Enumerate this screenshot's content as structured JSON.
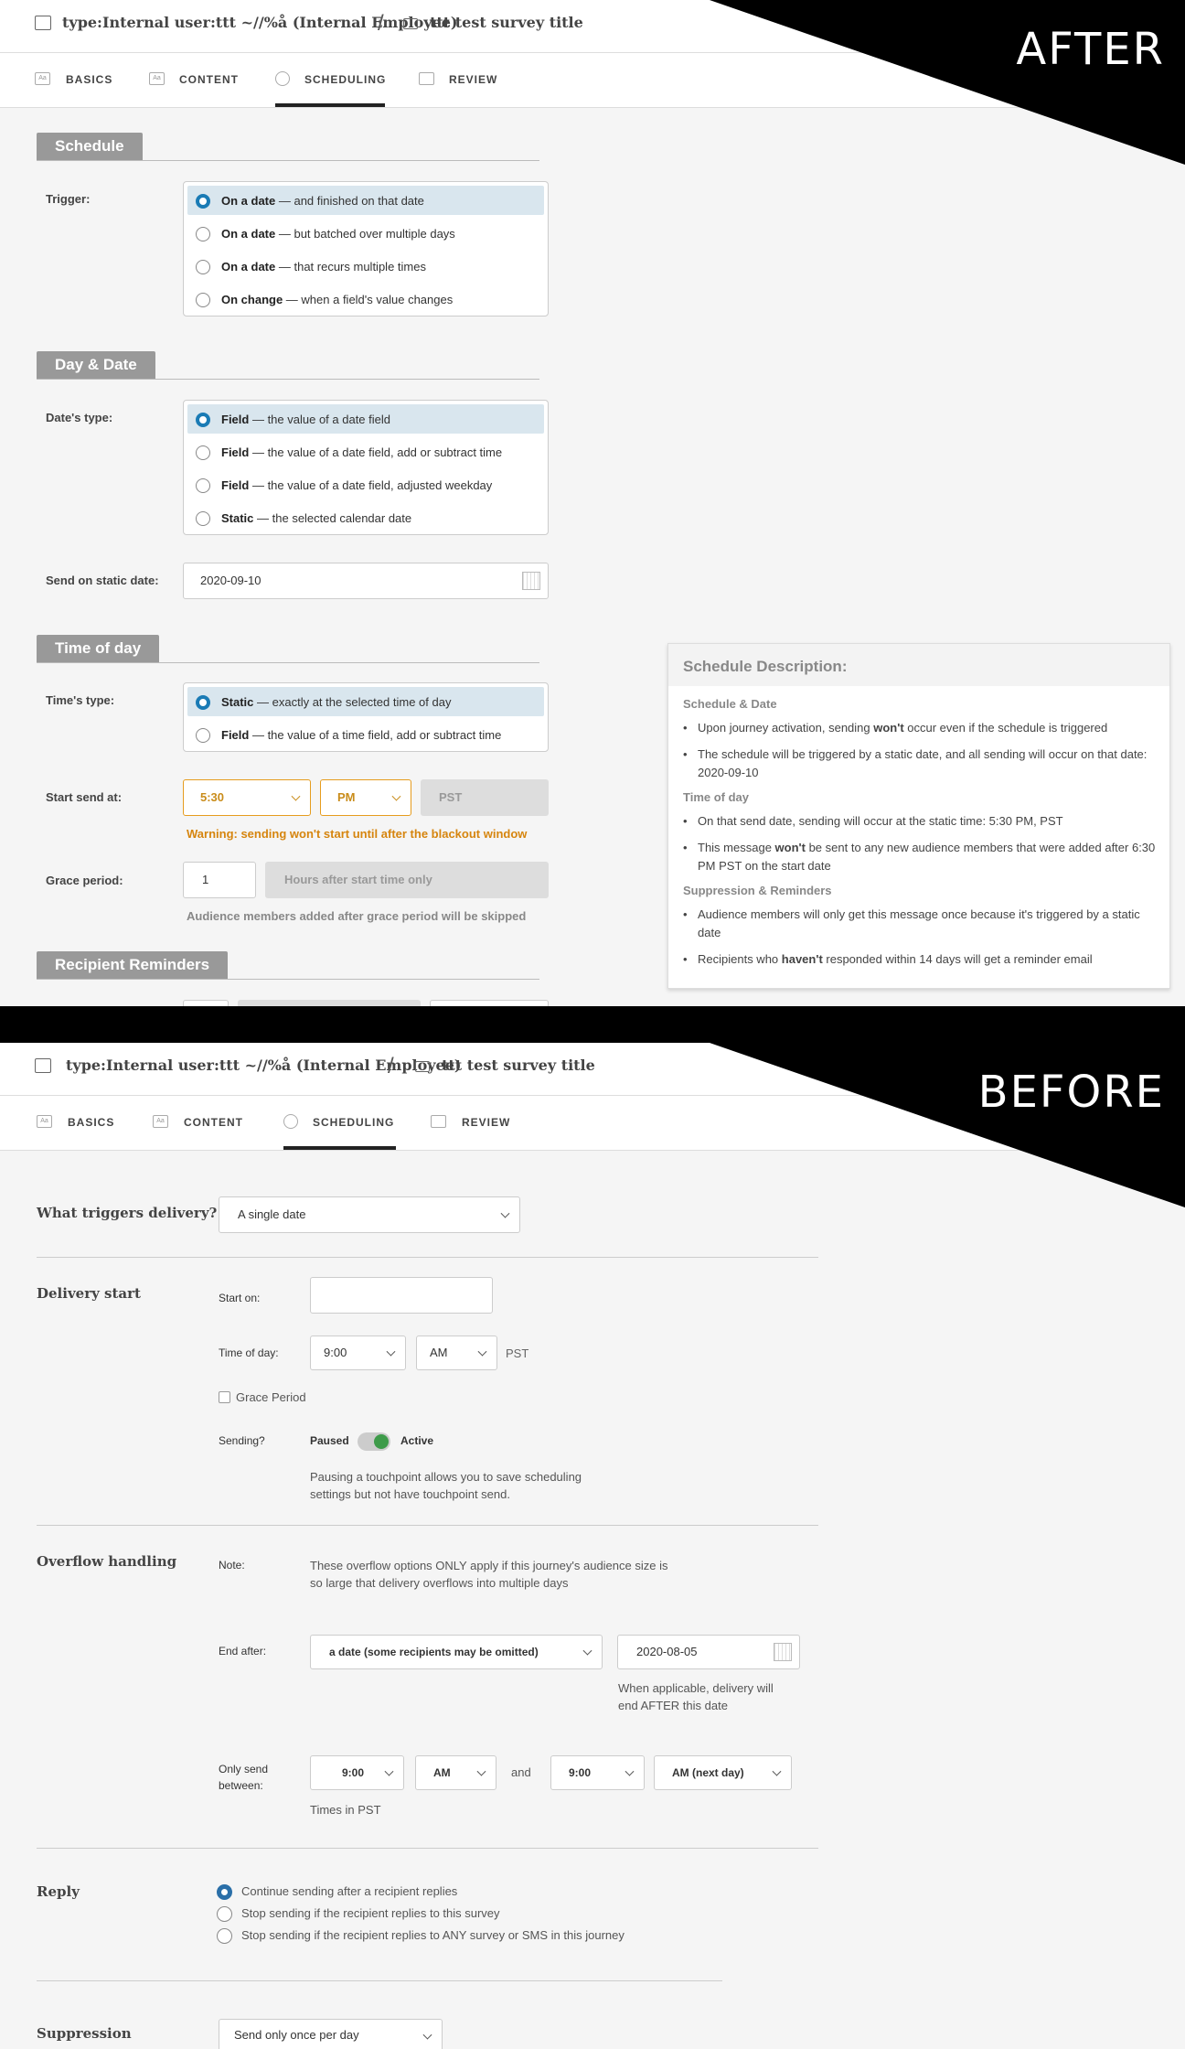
{
  "after": {
    "banner": "AFTER",
    "breadcrumb": {
      "org": "type:Internal user:ttt ~//%å (Internal Employee)",
      "separator": "/",
      "survey": "ttt test survey title"
    },
    "tabs": [
      {
        "label": "BASICS",
        "icon": "Aa"
      },
      {
        "label": "CONTENT",
        "icon": "Aa"
      },
      {
        "label": "SCHEDULING",
        "icon": "clock"
      },
      {
        "label": "REVIEW",
        "icon": "image"
      }
    ],
    "active_tab": "SCHEDULING",
    "schedule": {
      "heading": "Schedule",
      "trigger_label": "Trigger:",
      "options": [
        {
          "bold": "On a date",
          "rest": " — and finished on that date",
          "selected": true
        },
        {
          "bold": "On a date",
          "rest": " — but batched over multiple days",
          "selected": false
        },
        {
          "bold": "On a date",
          "rest": " — that recurs multiple times",
          "selected": false
        },
        {
          "bold": "On change",
          "rest": " — when a field's value changes",
          "selected": false
        }
      ]
    },
    "day_date": {
      "heading": "Day & Date",
      "type_label": "Date's type:",
      "options": [
        {
          "bold": "Field",
          "rest": " — the value of a date field",
          "selected": true
        },
        {
          "bold": "Field",
          "rest": " — the value of a date field, add or subtract time",
          "selected": false
        },
        {
          "bold": "Field",
          "rest": " — the value of a date field, adjusted weekday",
          "selected": false
        },
        {
          "bold": "Static",
          "rest": " — the selected calendar date",
          "selected": false
        }
      ],
      "static_label": "Send on static date:",
      "static_value": "2020-09-10"
    },
    "time_of_day": {
      "heading": "Time of day",
      "type_label": "Time's type:",
      "options": [
        {
          "bold": "Static",
          "rest": " — exactly at the selected time of day",
          "selected": true
        },
        {
          "bold": "Field",
          "rest": " — the value of a time field, add or subtract time",
          "selected": false
        }
      ],
      "start_label": "Start send at:",
      "time": "5:30",
      "ampm": "PM",
      "tz": "PST",
      "warning": "Warning: sending won't start until after the blackout window",
      "grace_label": "Grace period:",
      "grace_value": "1",
      "grace_unit": "Hours after start time only",
      "grace_hint": "Audience members added after grace period will be skipped"
    },
    "reminders_heading": "Recipient Reminders",
    "description": {
      "title": "Schedule Description:",
      "sections": [
        {
          "heading": "Schedule & Date",
          "items": [
            {
              "pre": "Upon journey activation, sending ",
              "bold": "won't",
              "post": " occur even if the schedule is triggered"
            },
            {
              "pre": "The schedule will be triggered by a static date, and all sending will occur on that date:  2020-09-10",
              "bold": "",
              "post": ""
            }
          ]
        },
        {
          "heading": "Time of day",
          "items": [
            {
              "pre": "On that send date, sending will occur at the static time:  5:30 PM, PST",
              "bold": "",
              "post": ""
            },
            {
              "pre": "This message ",
              "bold": "won't",
              "post": " be sent to any new audience members that were added after 6:30 PM PST on the start date"
            }
          ]
        },
        {
          "heading": "Suppression & Reminders",
          "items": [
            {
              "pre": "Audience members will only get this message once because it's triggered by a static date",
              "bold": "",
              "post": ""
            },
            {
              "pre": "Recipients who ",
              "bold": "haven't",
              "post": " responded within 14 days will get a reminder email"
            }
          ]
        }
      ]
    }
  },
  "before": {
    "banner": "BEFORE",
    "breadcrumb": {
      "org": "type:Internal user:ttt ~//%å (Internal Employee)",
      "separator": "/",
      "survey": "ttt test survey title"
    },
    "tabs": [
      {
        "label": "BASICS",
        "icon": "Aa"
      },
      {
        "label": "CONTENT",
        "icon": "Aa"
      },
      {
        "label": "SCHEDULING",
        "icon": "clock"
      },
      {
        "label": "REVIEW",
        "icon": "image"
      }
    ],
    "active_tab": "SCHEDULING",
    "trigger": {
      "label": "What triggers delivery?",
      "value": "A single date"
    },
    "delivery": {
      "label": "Delivery start",
      "start_label": "Start on:",
      "start_value": "",
      "time_label": "Time of day:",
      "time": "9:00",
      "ampm": "AM",
      "tz": "PST",
      "grace": "Grace Period",
      "sending_label": "Sending?",
      "paused": "Paused",
      "active": "Active",
      "note": "Pausing a touchpoint allows you to save scheduling settings but not have touchpoint send."
    },
    "overflow": {
      "label": "Overflow handling",
      "note_label": "Note:",
      "note": "These overflow options ONLY apply if this journey's audience size is so large that delivery overflows into multiple days",
      "end_label": "End after:",
      "end_value": "a date (some recipients may be omitted)",
      "end_date": "2020-08-05",
      "end_hint": "When applicable, delivery will end AFTER this date",
      "between_label": "Only send between:",
      "from_time": "9:00",
      "from_ampm": "AM",
      "and": "and",
      "to_time": "9:00",
      "to_ampm": "AM (next day)",
      "tz_note": "Times in PST"
    },
    "reply": {
      "label": "Reply",
      "options": [
        {
          "text": "Continue sending after a recipient replies",
          "selected": true
        },
        {
          "text": "Stop sending if the recipient replies to this survey",
          "selected": false
        },
        {
          "text": "Stop sending if the recipient replies to ANY survey or SMS in this journey",
          "selected": false
        }
      ]
    },
    "suppression": {
      "label": "Suppression",
      "value": "Send only once per day"
    }
  }
}
